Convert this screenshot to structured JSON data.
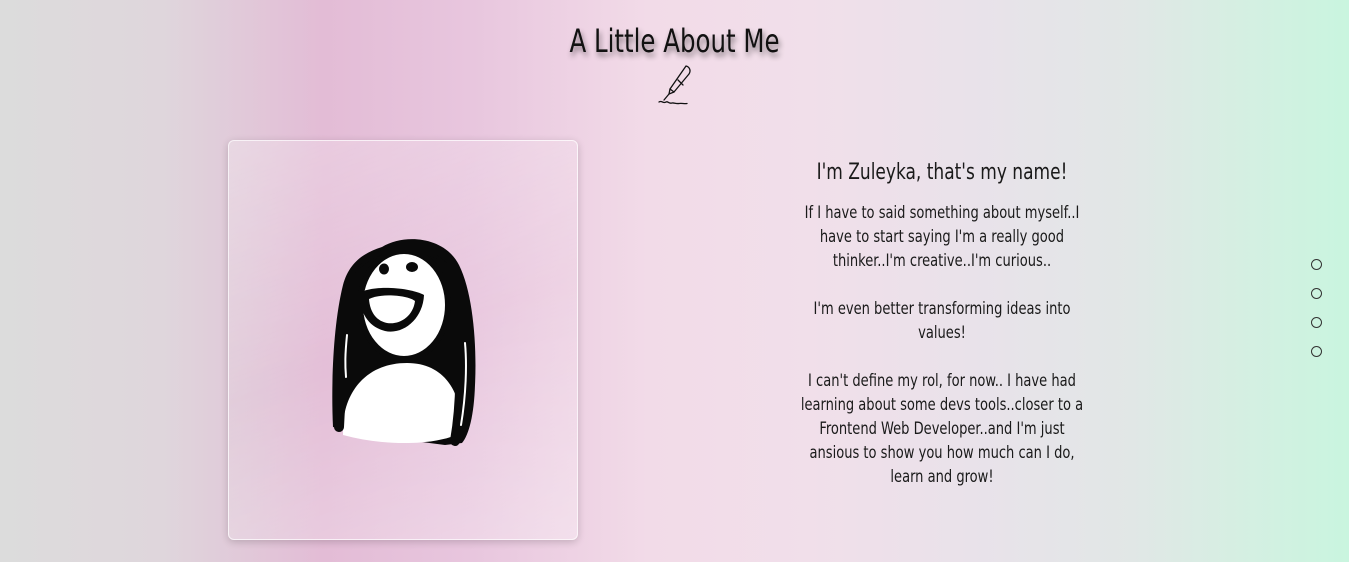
{
  "header": {
    "title": "A Little About Me",
    "icon": "fountain-pen-icon"
  },
  "profile": {
    "avatar_icon": "smiling-girl-doodle-icon"
  },
  "bio": {
    "heading": "I'm Zuleyka, that's my name!",
    "paragraphs": [
      "If I have to said something about myself..I have to start saying I'm a really good thinker..I'm creative..I'm curious..",
      "I'm even better transforming ideas into values!",
      "I can't define my rol, for now.. I have had learning about some devs tools..closer to a Frontend Web Developer..and I'm just ansious to show you how much can I do, learn and grow!"
    ]
  },
  "section_nav": {
    "dot_count": 4
  },
  "colors": {
    "background_left": "#dcdcdc",
    "background_pink": "#e3bcd6",
    "background_right": "#c9f5df",
    "text": "#1a1a1a"
  }
}
